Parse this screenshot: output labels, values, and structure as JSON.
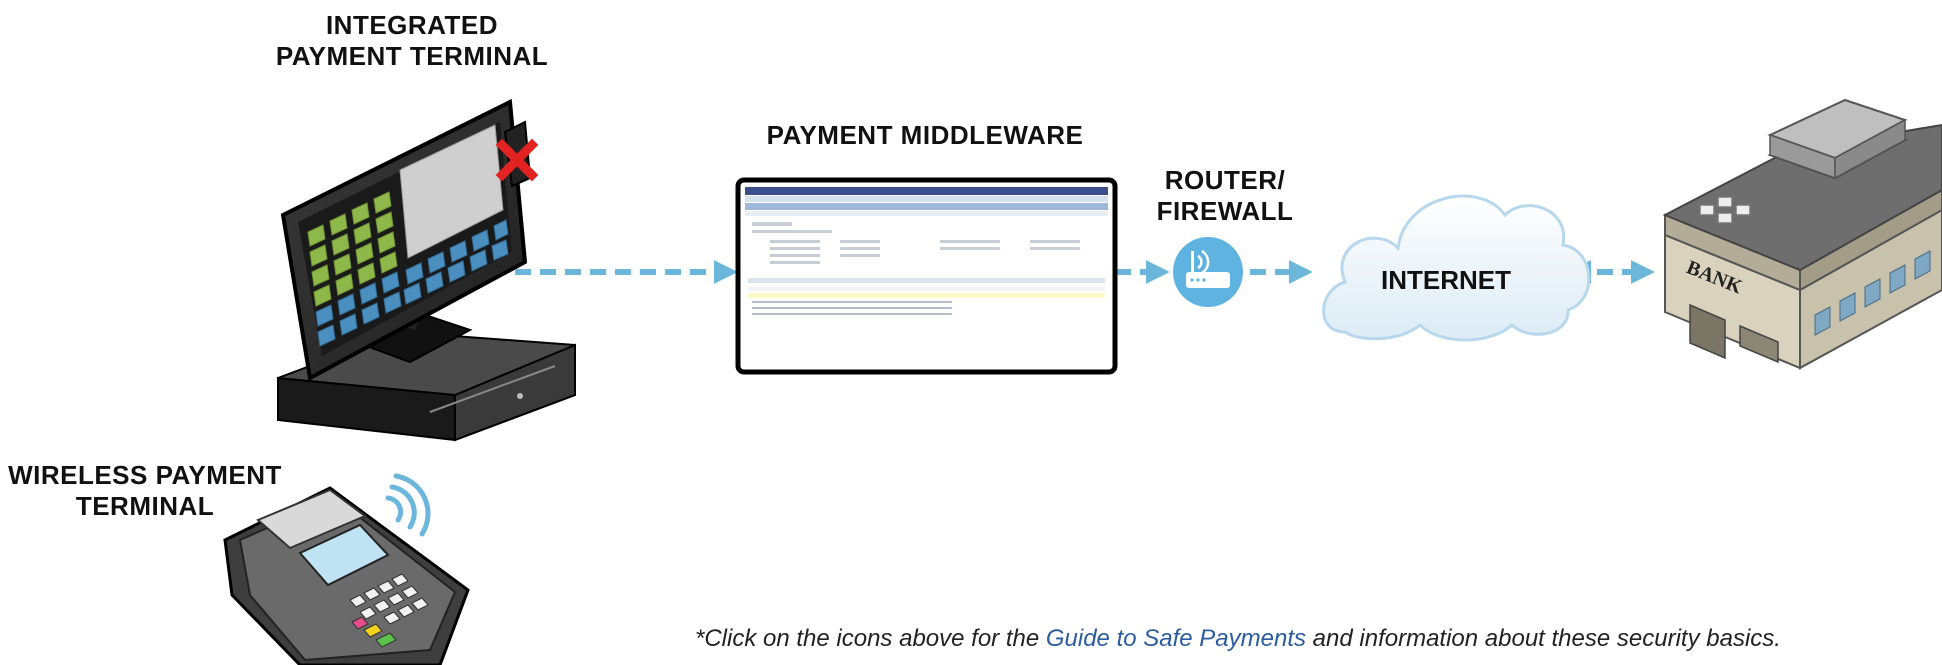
{
  "labels": {
    "integrated_line1": "INTEGRATED",
    "integrated_line2": "PAYMENT TERMINAL",
    "middleware": "PAYMENT MIDDLEWARE",
    "router_line1": "ROUTER/",
    "router_line2": "FIREWALL",
    "internet": "INTERNET",
    "wireless_line1": "WIRELESS PAYMENT",
    "wireless_line2": "TERMINAL",
    "bank_sign": "BANK"
  },
  "footnote": {
    "before": "*Click on the icons above for the ",
    "link": "Guide to Safe Payments",
    "after": " and information about these security basics."
  },
  "colors": {
    "arrow": "#6cb6dc",
    "router": "#5fb3e0",
    "link": "#2b5c9e",
    "warning_x": "#e32222"
  }
}
